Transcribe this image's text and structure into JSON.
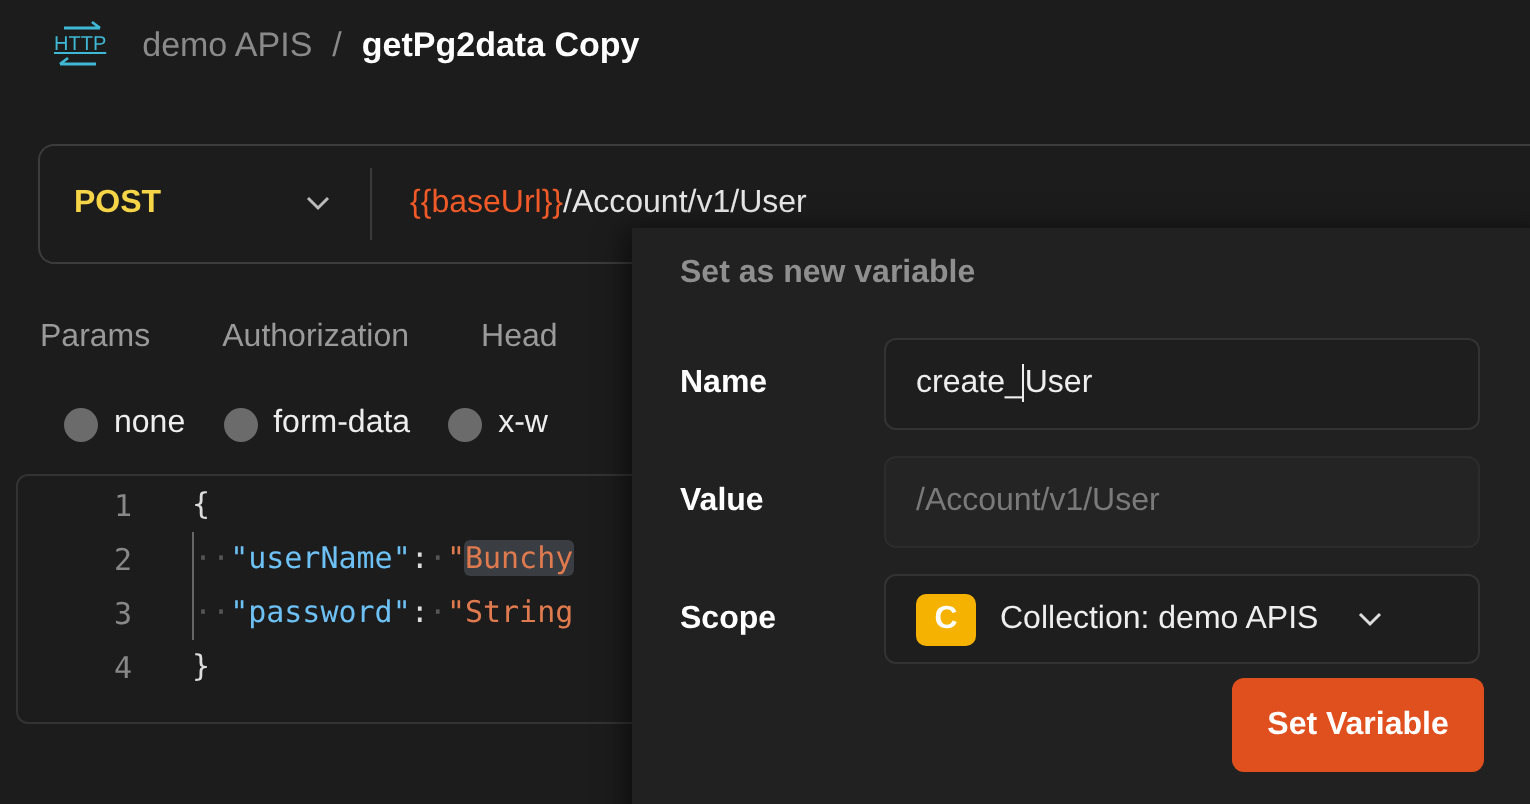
{
  "breadcrumb": {
    "icon_text": "HTTP",
    "collection": "demo APIS",
    "separator": "/",
    "request": "getPg2data Copy"
  },
  "request": {
    "method": "POST",
    "url_variable": "{{baseUrl}}",
    "url_path": "/Account/v1/User"
  },
  "tabs": [
    {
      "label": "Params"
    },
    {
      "label": "Authorization"
    },
    {
      "label": "Head"
    }
  ],
  "body_types": [
    {
      "label": "none",
      "selected": false
    },
    {
      "label": "form-data",
      "selected": false
    },
    {
      "label": "x-w",
      "selected": false
    }
  ],
  "editor": {
    "lines": [
      {
        "number": "1",
        "tokens": [
          {
            "kind": "punct",
            "text": "{"
          }
        ]
      },
      {
        "number": "2",
        "tokens": [
          {
            "kind": "space",
            "text": "··"
          },
          {
            "kind": "key",
            "text": "\"userName\""
          },
          {
            "kind": "punct",
            "text": ":"
          },
          {
            "kind": "space",
            "text": "·"
          },
          {
            "kind": "string",
            "text": "\"",
            "highlighted": false
          },
          {
            "kind": "string",
            "text": "Bunchy",
            "highlighted": true
          }
        ]
      },
      {
        "number": "3",
        "tokens": [
          {
            "kind": "space",
            "text": "··"
          },
          {
            "kind": "key",
            "text": "\"password\""
          },
          {
            "kind": "punct",
            "text": ":"
          },
          {
            "kind": "space",
            "text": "·"
          },
          {
            "kind": "string",
            "text": "\"String",
            "highlighted": false
          }
        ]
      },
      {
        "number": "4",
        "tokens": [
          {
            "kind": "punct",
            "text": "}"
          }
        ]
      }
    ]
  },
  "popup": {
    "title": "Set as new variable",
    "fields": [
      {
        "label": "Name",
        "kind": "text",
        "value": "create_User"
      },
      {
        "label": "Value",
        "kind": "readonly",
        "placeholder": "/Account/v1/User"
      },
      {
        "label": "Scope",
        "kind": "select",
        "badge": "C",
        "value": "Collection: demo APIS"
      }
    ],
    "button": "Set Variable"
  }
}
